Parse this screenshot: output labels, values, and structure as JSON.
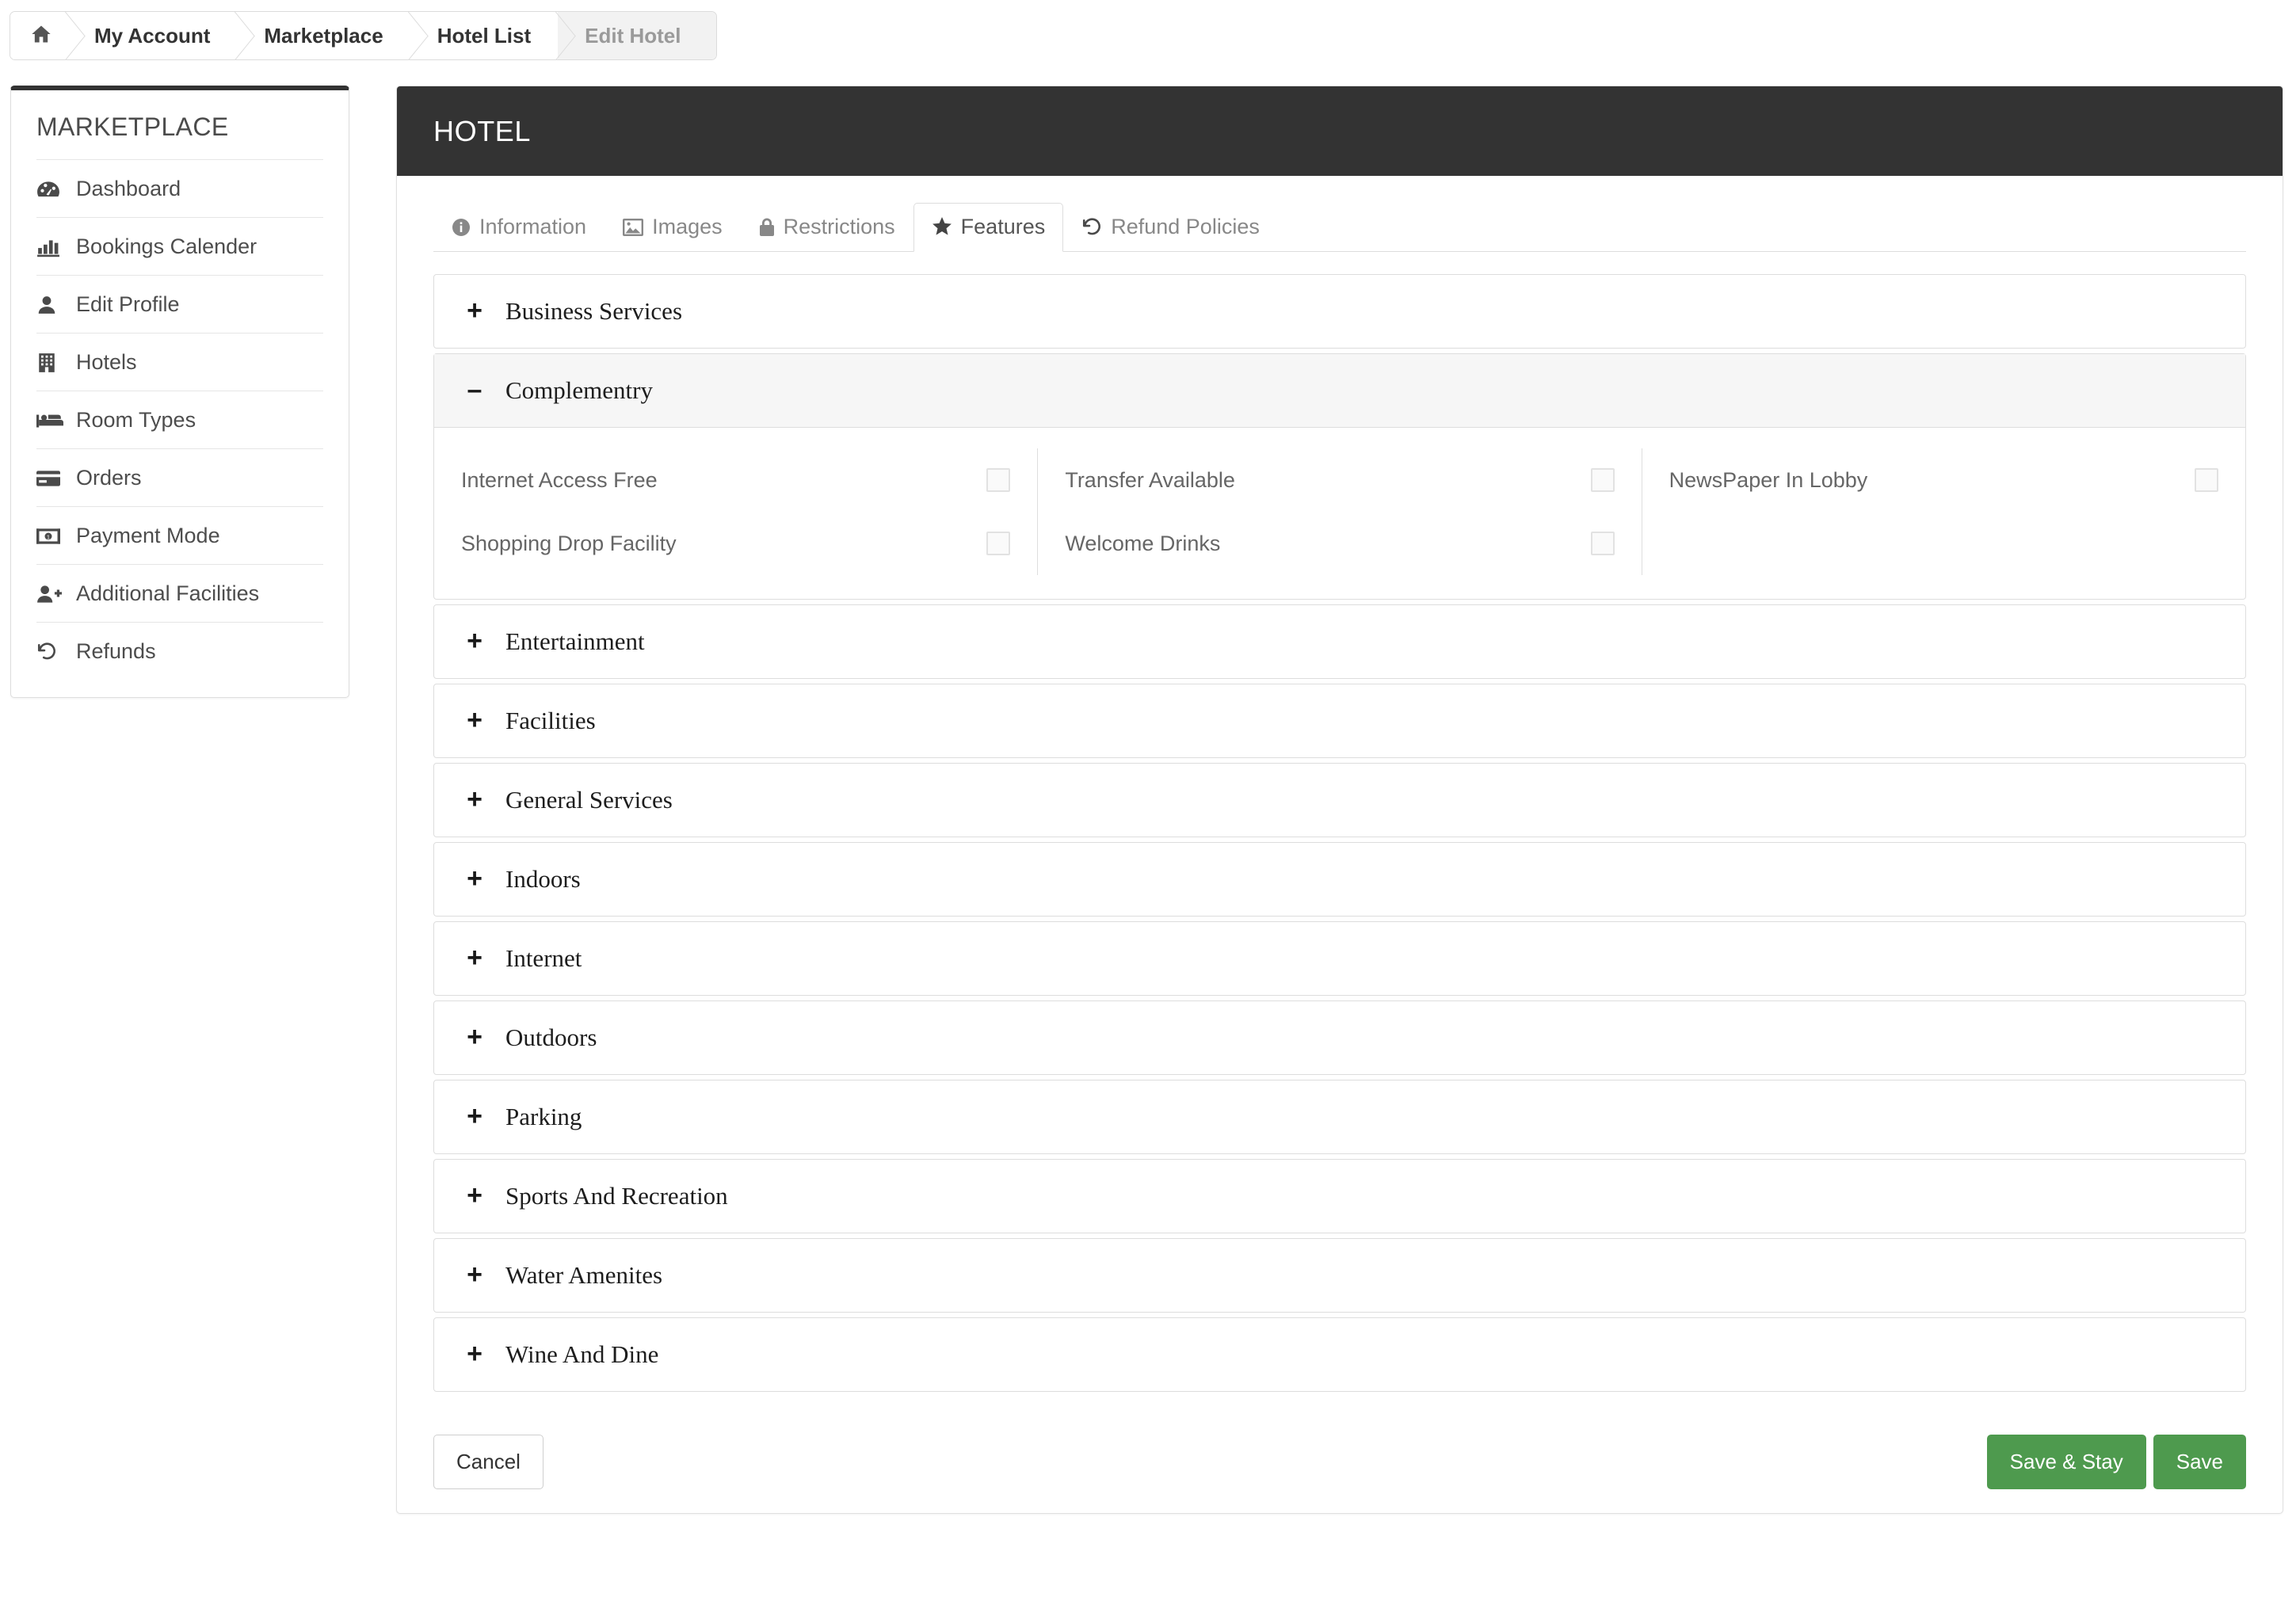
{
  "breadcrumb": {
    "home_icon": "home-icon",
    "items": [
      {
        "label": "My Account",
        "active": false
      },
      {
        "label": "Marketplace",
        "active": false
      },
      {
        "label": "Hotel List",
        "active": false
      },
      {
        "label": "Edit Hotel",
        "active": true
      }
    ]
  },
  "sidebar": {
    "title": "MARKETPLACE",
    "items": [
      {
        "label": "Dashboard",
        "icon": "dashboard-icon"
      },
      {
        "label": "Bookings Calender",
        "icon": "bar-chart-icon"
      },
      {
        "label": "Edit Profile",
        "icon": "user-icon"
      },
      {
        "label": "Hotels",
        "icon": "building-icon"
      },
      {
        "label": "Room Types",
        "icon": "bed-icon"
      },
      {
        "label": "Orders",
        "icon": "credit-card-icon"
      },
      {
        "label": "Payment Mode",
        "icon": "money-icon"
      },
      {
        "label": "Additional Facilities",
        "icon": "user-plus-icon"
      },
      {
        "label": "Refunds",
        "icon": "undo-icon"
      }
    ]
  },
  "panel": {
    "title": "HOTEL",
    "header_color": "#333333",
    "accent_color": "#4e9a4e"
  },
  "tabs": [
    {
      "label": "Information",
      "icon": "info-circle-icon",
      "active": false
    },
    {
      "label": "Images",
      "icon": "image-icon",
      "active": false
    },
    {
      "label": "Restrictions",
      "icon": "lock-icon",
      "active": false
    },
    {
      "label": "Features",
      "icon": "star-icon",
      "active": true
    },
    {
      "label": "Refund Policies",
      "icon": "undo-icon",
      "active": false
    }
  ],
  "accordion": [
    {
      "label": "Business Services",
      "expanded": false,
      "sign": "+"
    },
    {
      "label": "Complementry",
      "expanded": true,
      "sign": "–",
      "columns": [
        [
          {
            "label": "Internet Access Free",
            "checked": false
          },
          {
            "label": "Shopping Drop Facility",
            "checked": false
          }
        ],
        [
          {
            "label": "Transfer Available",
            "checked": false
          },
          {
            "label": "Welcome Drinks",
            "checked": false
          }
        ],
        [
          {
            "label": "NewsPaper In Lobby",
            "checked": false
          }
        ]
      ]
    },
    {
      "label": "Entertainment",
      "expanded": false,
      "sign": "+"
    },
    {
      "label": "Facilities",
      "expanded": false,
      "sign": "+"
    },
    {
      "label": "General Services",
      "expanded": false,
      "sign": "+"
    },
    {
      "label": "Indoors",
      "expanded": false,
      "sign": "+"
    },
    {
      "label": "Internet",
      "expanded": false,
      "sign": "+"
    },
    {
      "label": "Outdoors",
      "expanded": false,
      "sign": "+"
    },
    {
      "label": "Parking",
      "expanded": false,
      "sign": "+"
    },
    {
      "label": "Sports And Recreation",
      "expanded": false,
      "sign": "+"
    },
    {
      "label": "Water Amenites",
      "expanded": false,
      "sign": "+"
    },
    {
      "label": "Wine And Dine",
      "expanded": false,
      "sign": "+"
    }
  ],
  "footer": {
    "cancel_label": "Cancel",
    "save_stay_label": "Save & Stay",
    "save_label": "Save"
  }
}
